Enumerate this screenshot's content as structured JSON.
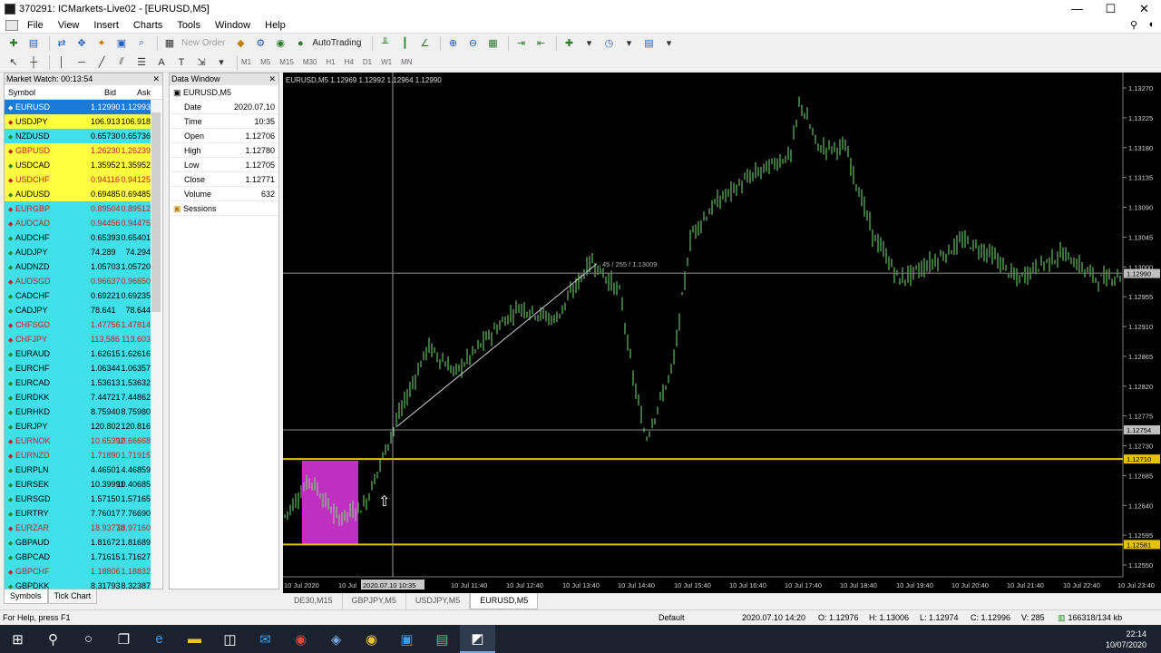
{
  "window": {
    "title": "370291: ICMarkets-Live02 - [EURUSD,M5]",
    "min": "—",
    "max": "☐",
    "close": "✕"
  },
  "menu": [
    "File",
    "View",
    "Insert",
    "Charts",
    "Tools",
    "Window",
    "Help"
  ],
  "toolbar": {
    "new_order": "New Order",
    "autotrading": "AutoTrading"
  },
  "timeframes": [
    "M1",
    "M5",
    "M15",
    "M30",
    "H1",
    "H4",
    "D1",
    "W1",
    "MN"
  ],
  "market_watch": {
    "title": "Market Watch: 00:13:54",
    "col_symbol": "Symbol",
    "col_bid": "Bid",
    "col_ask": "Ask",
    "rows": [
      {
        "symbol": "EURUSD",
        "bid": "1.12990",
        "ask": "1.12993",
        "bg": "#1a7ad8",
        "fg": "#ffffff",
        "dir": "up"
      },
      {
        "symbol": "USDJPY",
        "bid": "106.913",
        "ask": "106.918",
        "bg": "#ffff40",
        "fg": "#000000",
        "dir": "dn"
      },
      {
        "symbol": "NZDUSD",
        "bid": "0.65730",
        "ask": "0.65736",
        "bg": "#3fe0e8",
        "fg": "#000000",
        "dir": "up"
      },
      {
        "symbol": "GBPUSD",
        "bid": "1.26230",
        "ask": "1.26239",
        "bg": "#ffff40",
        "fg": "#c82020",
        "dir": "dn"
      },
      {
        "symbol": "USDCAD",
        "bid": "1.35952",
        "ask": "1.35952",
        "bg": "#ffff40",
        "fg": "#000000",
        "dir": "up"
      },
      {
        "symbol": "USDCHF",
        "bid": "0.94116",
        "ask": "0.94125",
        "bg": "#ffff40",
        "fg": "#c82020",
        "dir": "dn"
      },
      {
        "symbol": "AUDUSD",
        "bid": "0.69485",
        "ask": "0.69485",
        "bg": "#ffff40",
        "fg": "#000000",
        "dir": "up"
      },
      {
        "symbol": "EURGBP",
        "bid": "0.89504",
        "ask": "0.89512",
        "bg": "#3fe0e8",
        "fg": "#c82020",
        "dir": "dn"
      },
      {
        "symbol": "AUDCAD",
        "bid": "0.94456",
        "ask": "0.94475",
        "bg": "#3fe0e8",
        "fg": "#c82020",
        "dir": "dn"
      },
      {
        "symbol": "AUDCHF",
        "bid": "0.65393",
        "ask": "0.65401",
        "bg": "#3fe0e8",
        "fg": "#000000",
        "dir": "up"
      },
      {
        "symbol": "AUDJPY",
        "bid": "74.289",
        "ask": "74.294",
        "bg": "#3fe0e8",
        "fg": "#000000",
        "dir": "up"
      },
      {
        "symbol": "AUDNZD",
        "bid": "1.05703",
        "ask": "1.05720",
        "bg": "#3fe0e8",
        "fg": "#000000",
        "dir": "up"
      },
      {
        "symbol": "AUDSGD",
        "bid": "0.96637",
        "ask": "0.96650",
        "bg": "#3fe0e8",
        "fg": "#c82020",
        "dir": "dn"
      },
      {
        "symbol": "CADCHF",
        "bid": "0.69221",
        "ask": "0.69235",
        "bg": "#3fe0e8",
        "fg": "#000000",
        "dir": "up"
      },
      {
        "symbol": "CADJPY",
        "bid": "78.641",
        "ask": "78.644",
        "bg": "#3fe0e8",
        "fg": "#000000",
        "dir": "up"
      },
      {
        "symbol": "CHFSGD",
        "bid": "1.47756",
        "ask": "1.47814",
        "bg": "#3fe0e8",
        "fg": "#c82020",
        "dir": "dn"
      },
      {
        "symbol": "CHFJPY",
        "bid": "113.586",
        "ask": "113.603",
        "bg": "#3fe0e8",
        "fg": "#c82020",
        "dir": "dn"
      },
      {
        "symbol": "EURAUD",
        "bid": "1.62615",
        "ask": "1.62616",
        "bg": "#3fe0e8",
        "fg": "#000000",
        "dir": "up"
      },
      {
        "symbol": "EURCHF",
        "bid": "1.06344",
        "ask": "1.06357",
        "bg": "#3fe0e8",
        "fg": "#000000",
        "dir": "up"
      },
      {
        "symbol": "EURCAD",
        "bid": "1.53613",
        "ask": "1.53632",
        "bg": "#3fe0e8",
        "fg": "#000000",
        "dir": "up"
      },
      {
        "symbol": "EURDKK",
        "bid": "7.44721",
        "ask": "7.44862",
        "bg": "#3fe0e8",
        "fg": "#000000",
        "dir": "up"
      },
      {
        "symbol": "EURHKD",
        "bid": "8.75940",
        "ask": "8.75980",
        "bg": "#3fe0e8",
        "fg": "#000000",
        "dir": "up"
      },
      {
        "symbol": "EURJPY",
        "bid": "120.802",
        "ask": "120.816",
        "bg": "#3fe0e8",
        "fg": "#000000",
        "dir": "up"
      },
      {
        "symbol": "EURNOK",
        "bid": "10.65392",
        "ask": "10.66668",
        "bg": "#3fe0e8",
        "fg": "#c82020",
        "dir": "dn"
      },
      {
        "symbol": "EURNZD",
        "bid": "1.71890",
        "ask": "1.71915",
        "bg": "#3fe0e8",
        "fg": "#c82020",
        "dir": "dn"
      },
      {
        "symbol": "EURPLN",
        "bid": "4.46501",
        "ask": "4.46859",
        "bg": "#3fe0e8",
        "fg": "#000000",
        "dir": "up"
      },
      {
        "symbol": "EURSEK",
        "bid": "10.39991",
        "ask": "10.40685",
        "bg": "#3fe0e8",
        "fg": "#000000",
        "dir": "up"
      },
      {
        "symbol": "EURSGD",
        "bid": "1.57150",
        "ask": "1.57165",
        "bg": "#3fe0e8",
        "fg": "#000000",
        "dir": "up"
      },
      {
        "symbol": "EURTRY",
        "bid": "7.76017",
        "ask": "7.76690",
        "bg": "#3fe0e8",
        "fg": "#000000",
        "dir": "up"
      },
      {
        "symbol": "EURZAR",
        "bid": "18.93770",
        "ask": "18.97160",
        "bg": "#3fe0e8",
        "fg": "#c82020",
        "dir": "dn"
      },
      {
        "symbol": "GBPAUD",
        "bid": "1.81672",
        "ask": "1.81689",
        "bg": "#3fe0e8",
        "fg": "#000000",
        "dir": "up"
      },
      {
        "symbol": "GBPCAD",
        "bid": "1.71615",
        "ask": "1.71627",
        "bg": "#3fe0e8",
        "fg": "#000000",
        "dir": "up"
      },
      {
        "symbol": "GBPCHF",
        "bid": "1.18806",
        "ask": "1.18832",
        "bg": "#3fe0e8",
        "fg": "#c82020",
        "dir": "dn"
      },
      {
        "symbol": "GBPDKK",
        "bid": "8.31793",
        "ask": "8.32387",
        "bg": "#3fe0e8",
        "fg": "#000000",
        "dir": "up"
      }
    ],
    "tabs": [
      "Symbols",
      "Tick Chart"
    ]
  },
  "data_window": {
    "title": "Data Window",
    "symbol": "EURUSD,M5",
    "rows": [
      {
        "k": "Date",
        "v": "2020.07.10"
      },
      {
        "k": "Time",
        "v": "10:35"
      },
      {
        "k": "Open",
        "v": "1.12706"
      },
      {
        "k": "High",
        "v": "1.12780"
      },
      {
        "k": "Low",
        "v": "1.12705"
      },
      {
        "k": "Close",
        "v": "1.12771"
      },
      {
        "k": "Volume",
        "v": "632"
      }
    ],
    "sessions": "Sessions"
  },
  "chart": {
    "header": "EURUSD,M5  1.12969 1.12992 1.12964 1.12990",
    "crosshair_label": "45 / 255 / 1.13009",
    "crosshair_time": "2020.07.10 10:35",
    "price_labels": [
      "1.13270",
      "1.13225",
      "1.13180",
      "1.13135",
      "1.13090",
      "1.13045",
      "1.13000",
      "1.12955",
      "1.12910",
      "1.12865",
      "1.12820",
      "1.12775",
      "1.12730",
      "1.12685",
      "1.12640",
      "1.12595",
      "1.12550"
    ],
    "tagged_prices": [
      {
        "price": "1.12990",
        "bg": "#c0c0c0",
        "fg": "#000000"
      },
      {
        "price": "1.12754",
        "bg": "#c0c0c0",
        "fg": "#000000"
      },
      {
        "price": "1.12710",
        "bg": "#e6c200",
        "fg": "#000000"
      },
      {
        "price": "1.12581",
        "bg": "#e6c200",
        "fg": "#000000"
      }
    ],
    "time_labels": [
      "10 Jul 2020",
      "10 Jul",
      "10 Jul 11:40",
      "10 Jul 12:40",
      "10 Jul 13:40",
      "10 Jul 14:40",
      "10 Jul 15:40",
      "10 Jul 16:40",
      "10 Jul 17:40",
      "10 Jul 18:40",
      "10 Jul 19:40",
      "10 Jul 20:40",
      "10 Jul 21:40",
      "10 Jul 22:40",
      "10 Jul 23:40"
    ],
    "colors": {
      "candle": "#7de07d",
      "level": "#e6c200",
      "box": "#c030c0",
      "trend": "#d0d0d0",
      "crosshair": "#9a9a9a"
    }
  },
  "chart_tabs": [
    "DE30,M15",
    "GBPJPY,M5",
    "USDJPY,M5",
    "EURUSD,M5"
  ],
  "status": {
    "help": "For Help, press F1",
    "profile": "Default",
    "time": "2020.07.10 14:20",
    "open": "O: 1.12976",
    "high": "H: 1.13006",
    "low": "L: 1.12974",
    "close": "C: 1.12996",
    "volume": "V: 285",
    "traffic": "166318/134 kb"
  },
  "clock": {
    "time": "22:14",
    "date": "10/07/2020"
  }
}
